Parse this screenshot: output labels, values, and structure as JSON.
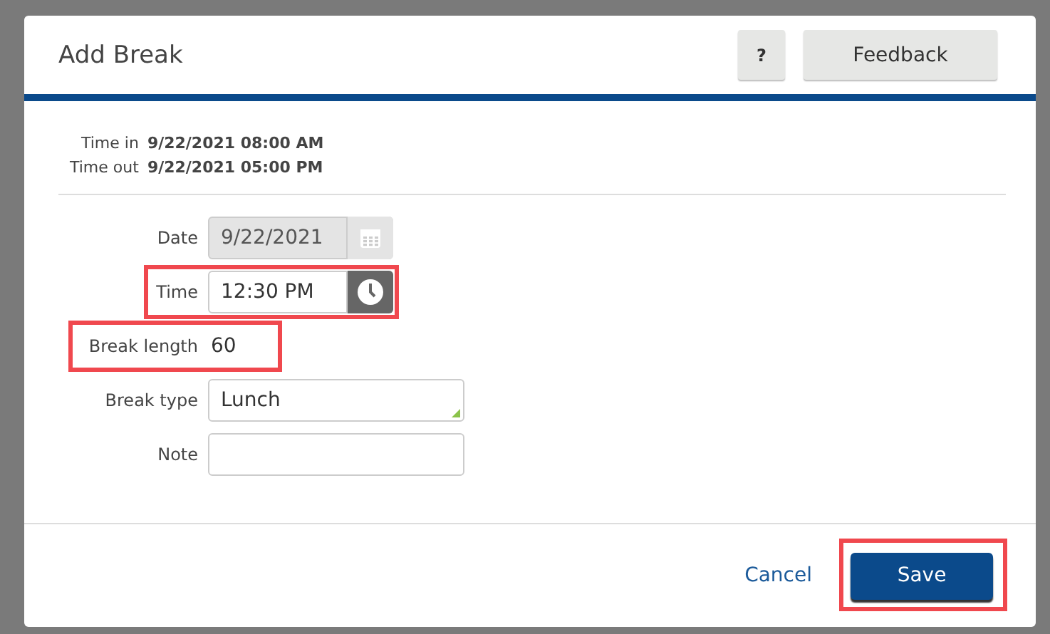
{
  "dialog": {
    "title": "Add Break",
    "help_button": "?",
    "feedback_button": "Feedback"
  },
  "summary": [
    {
      "label": "Time in",
      "value": "9/22/2021 08:00 AM"
    },
    {
      "label": "Time out",
      "value": "9/22/2021 05:00 PM"
    }
  ],
  "fields": [
    {
      "kind": "date",
      "label": "Date",
      "value": "9/22/2021",
      "disabled": true,
      "highlighted": false
    },
    {
      "kind": "time",
      "label": "Time",
      "value": "12:30 PM",
      "disabled": false,
      "highlighted": true
    },
    {
      "kind": "plain",
      "label": "Break length",
      "value": "60",
      "disabled": false,
      "highlighted": true
    },
    {
      "kind": "select",
      "label": "Break type",
      "value": "Lunch",
      "disabled": false,
      "highlighted": false
    },
    {
      "kind": "text",
      "label": "Note",
      "disabled": false,
      "highlighted": false
    }
  ],
  "footer": {
    "cancel": "Cancel",
    "save": "Save",
    "save_highlighted": true
  }
}
